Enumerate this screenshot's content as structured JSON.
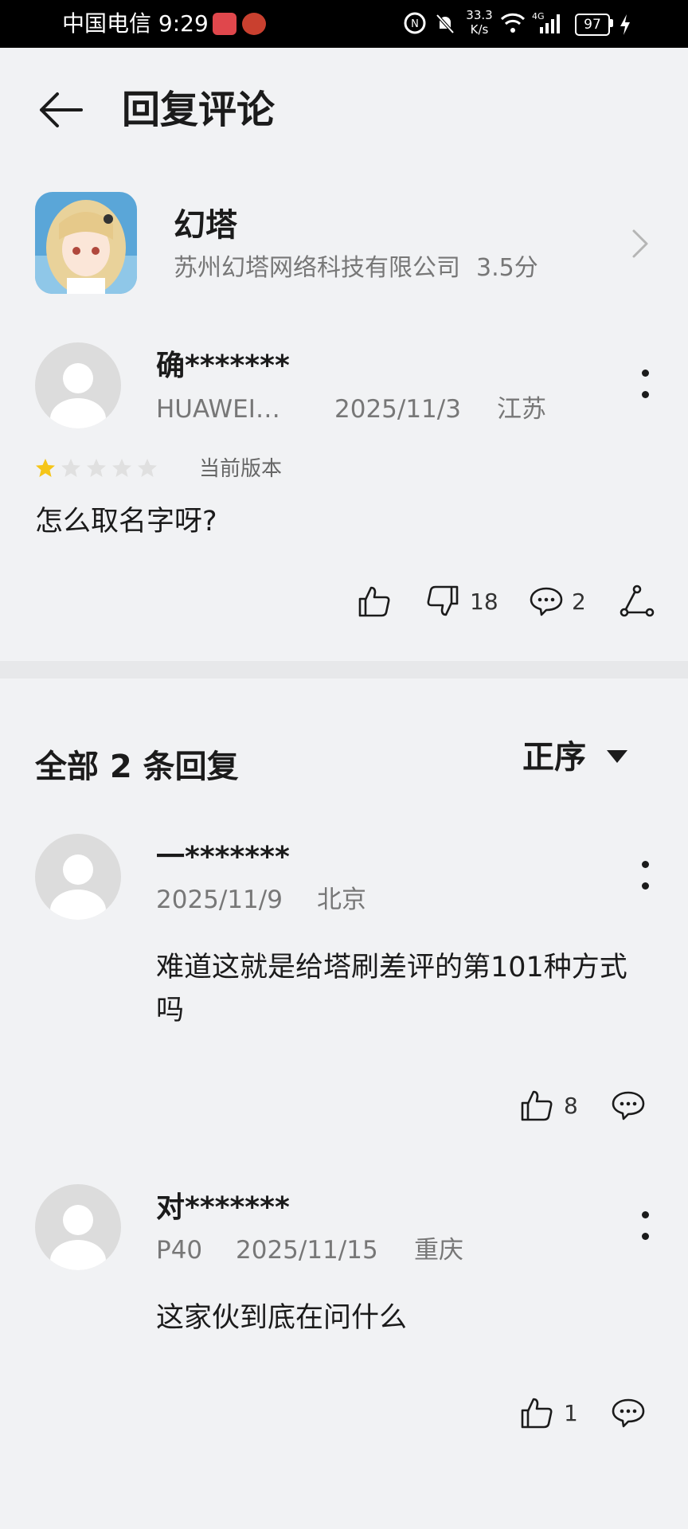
{
  "status_bar": {
    "carrier_time": "中国电信 9:29",
    "net_speed_value": "33.3",
    "net_speed_unit": "K/s",
    "battery": "97",
    "network_type": "4G"
  },
  "header": {
    "title": "回复评论"
  },
  "app": {
    "name": "幻塔",
    "developer": "苏州幻塔网络科技有限公司",
    "rating": "3.5分"
  },
  "review": {
    "user": "确*******",
    "device": "HUAWEI…",
    "date": "2025/11/3",
    "location": "江苏",
    "stars": 1,
    "max_stars": 5,
    "version_label": "当前版本",
    "text": "怎么取名字呀?",
    "dislike_count": "18",
    "comment_count": "2"
  },
  "replies_section": {
    "title": "全部 2 条回复",
    "sort_label": "正序"
  },
  "replies": [
    {
      "user": "一*******",
      "date": "2025/11/9",
      "location": "北京",
      "text": "难道这就是给塔刷差评的第101种方式吗",
      "like_count": "8"
    },
    {
      "user": "对*******",
      "device": "P40",
      "date": "2025/11/15",
      "location": "重庆",
      "text": "这家伙到底在问什么",
      "like_count": "1"
    }
  ],
  "colors": {
    "background": "#f1f2f4",
    "star_active": "#f5c518",
    "star_inactive": "#e0e0e0",
    "secondary_text": "#777777"
  }
}
